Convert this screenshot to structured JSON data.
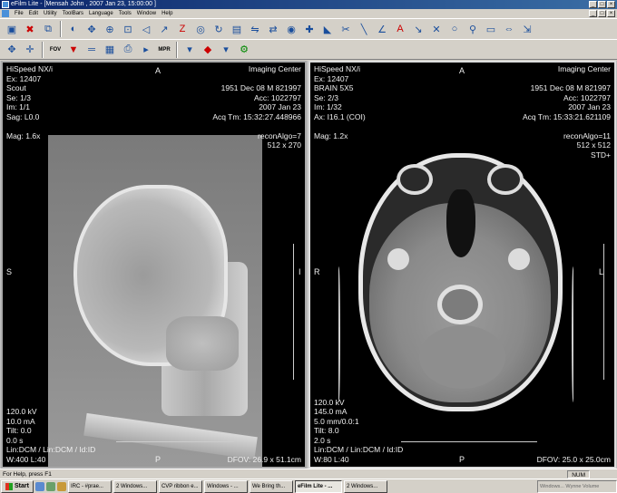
{
  "window": {
    "title": "eFilm Lite - [Mensah John  , 2007 Jan 23, 15:00:00 ]"
  },
  "menu": [
    "File",
    "Edit",
    "Utility",
    "ToolBars",
    "Language",
    "Tools",
    "Window",
    "Help"
  ],
  "toolbar_icons": [
    "open-icon",
    "close-study-icon",
    "layout-icon",
    "window-level-icon",
    "pan-icon",
    "zoom-icon",
    "cine-icon",
    "measure-icon",
    "annotate-icon",
    "invert-icon",
    "rotate-icon",
    "flip-icon",
    "mpr-icon",
    "3d-icon",
    "print-icon",
    "export-icon"
  ],
  "toolbar2": {
    "fov": "FOV",
    "mpr": "MPR"
  },
  "left_viewport": {
    "tl": [
      "HiSpeed NX/i",
      "Ex: 12407",
      "Scout",
      "Se: 1/3",
      "Im: 1/1",
      "Sag: L0.0",
      "",
      "Mag: 1.6x"
    ],
    "top_orient": "A",
    "tr": [
      "Imaging Center",
      "",
      "1951 Dec 08  M  821997",
      "Acc: 1022797",
      "2007 Jan 23",
      "Acq Tm: 15:32:27.448966",
      "",
      "reconAlgo=7",
      "512 x 270"
    ],
    "left_orient": "S",
    "right_orient": "I",
    "bl": [
      "120.0 kV",
      "10.0 mA",
      "Tilt: 0.0",
      "0.0 s",
      "Lin:DCM / Lin:DCM / Id:ID",
      "W:400  L:40"
    ],
    "bottom_orient": "P",
    "br": [
      "DFOV: 26.9 x 51.1cm"
    ]
  },
  "right_viewport": {
    "tl": [
      "HiSpeed NX/i",
      "Ex: 12407",
      "BRAIN 5X5",
      "Se: 2/3",
      "Im: 1/32",
      "Ax: I16.1 (COI)",
      "",
      "Mag: 1.2x"
    ],
    "top_orient": "A",
    "tr": [
      "Imaging Center",
      "",
      "1951 Dec 08  M  821997",
      "Acc: 1022797",
      "2007 Jan 23",
      "Acq Tm: 15:33:21.621109",
      "",
      "reconAlgo=11",
      "512 x 512",
      "STD+"
    ],
    "left_orient": "R",
    "right_orient": "L",
    "bl": [
      "120.0 kV",
      "145.0 mA",
      "5.0 mm/0.0:1",
      "Tilt: 8.0",
      "2.0 s",
      "Lin:DCM / Lin:DCM / Id:ID",
      "W:80  L:40"
    ],
    "bottom_orient": "P",
    "br": [
      "DFOV: 25.0 x 25.0cm"
    ]
  },
  "statusbar": {
    "text": "For Help, press F1",
    "num": "NUM"
  },
  "taskbar": {
    "start": "Start",
    "tasks": [
      "IRC - #prae...",
      "2 Windows...",
      "CVP ribbon e...",
      "Windows - ...",
      "We Bring th...",
      "eFilm Lite - ...",
      "2 Windows..."
    ],
    "active_index": 5,
    "tray": "Windows... Wynne Volume"
  }
}
